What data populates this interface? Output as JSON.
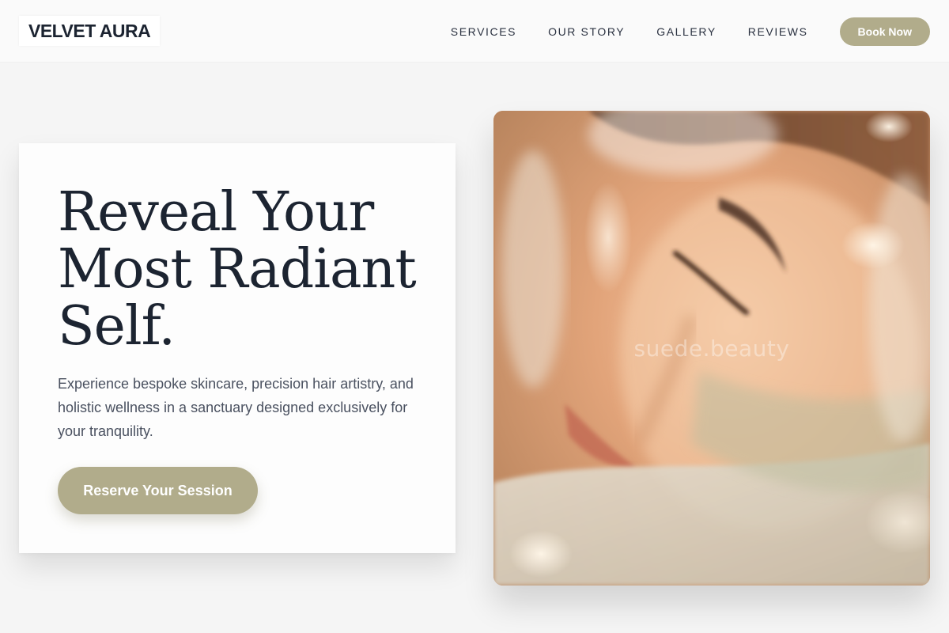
{
  "header": {
    "logo": "VELVET AURA",
    "nav": [
      {
        "label": "SERVICES"
      },
      {
        "label": "OUR STORY"
      },
      {
        "label": "GALLERY"
      },
      {
        "label": "REVIEWS"
      }
    ],
    "book_label": "Book Now"
  },
  "hero": {
    "title_lines": [
      "Reveal Your",
      "Most Radiant",
      "Self."
    ],
    "description": "Experience bespoke skincare, precision hair artistry, and holistic wellness in a sanctuary designed exclusively for your tranquility.",
    "cta_label": "Reserve Your Session"
  },
  "image": {
    "watermark": "suede.beauty",
    "subject": "close-up of woman with closed eyes in warm soft light"
  },
  "colors": {
    "accent": "#b1ac8b",
    "text_dark": "#1c2431",
    "text_muted": "#4a5160",
    "page_bg": "#f5f5f5"
  }
}
